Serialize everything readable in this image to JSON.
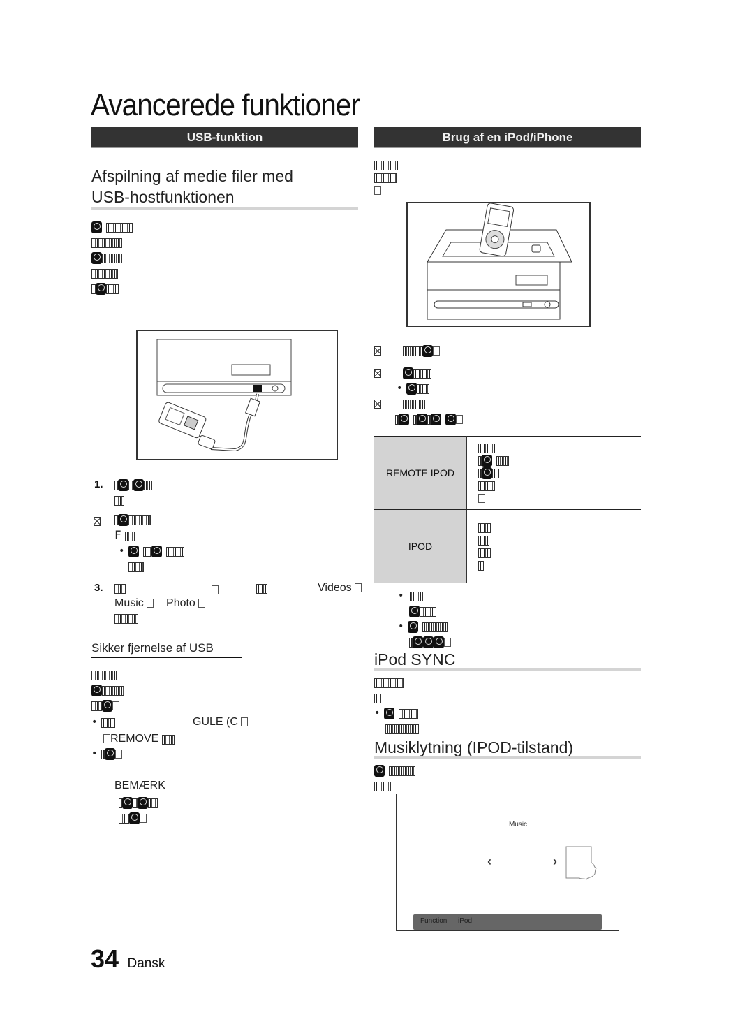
{
  "page": {
    "title": "Avancerede funktioner",
    "page_number": "34",
    "language": "Dansk"
  },
  "left": {
    "band": "USB-funktion",
    "heading_line1": "Afspilning af medie filer med",
    "heading_line2": "USB-hostfunktionen",
    "step1_num": "1.",
    "step2_marker": "x-box",
    "step2_f": "F",
    "step3_num": "3.",
    "step3_videos": "Videos",
    "step3_music": "Music",
    "step3_photo": "Photo",
    "subheading": "Sikker fjernelse af USB",
    "bullet1_gule": "GULE (C",
    "bullet1_remove": "REMOVE",
    "note_label": "BEMÆRK",
    "figure": "usb-device-connected-to-unit"
  },
  "right": {
    "band": "Brug af en iPod/iPhone",
    "figure": "ipod-docked-on-unit",
    "table": [
      {
        "mode": "REMOTE IPOD"
      },
      {
        "mode": "IPOD"
      }
    ],
    "sync_heading": "iPod SYNC",
    "music_heading": "Musiklytning (IPOD-tilstand)",
    "screen": {
      "label": "Music",
      "prev_icon": "chevron-left",
      "next_icon": "chevron-right",
      "bar_function": "Function",
      "bar_value": "iPod"
    }
  }
}
